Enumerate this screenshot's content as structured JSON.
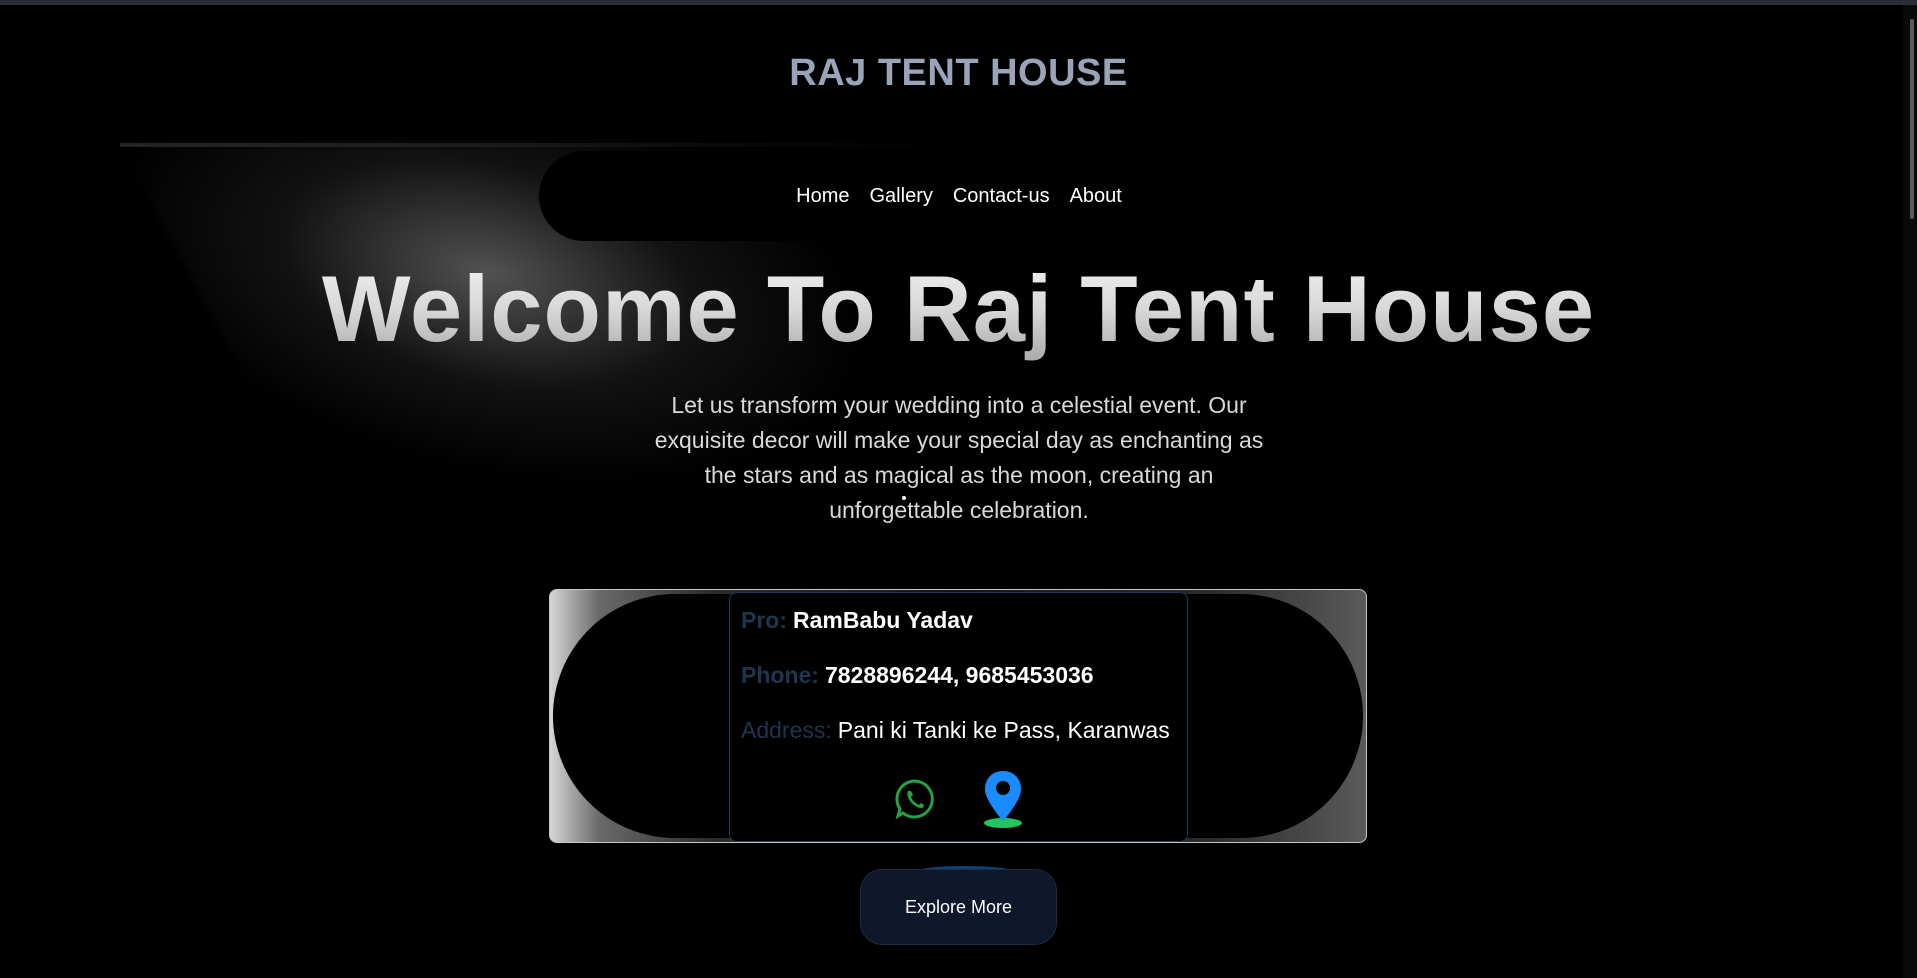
{
  "brand": {
    "title": "RAJ TENT HOUSE"
  },
  "nav": {
    "items": [
      {
        "label": "Home"
      },
      {
        "label": "Gallery"
      },
      {
        "label": "Contact-us"
      },
      {
        "label": "About"
      }
    ]
  },
  "hero": {
    "title": "Welcome To Raj Tent House",
    "description": "Let us transform your wedding into a celestial event. Our exquisite decor will make your special day as enchanting as the stars and as magical as the moon, creating an unforgettable celebration."
  },
  "contact": {
    "pro_label": "Pro:",
    "pro_value": "RamBabu Yadav",
    "phone_label": "Phone:",
    "phone_value": "7828896244, 9685453036",
    "address_label": "Address:",
    "address_value": "Pani ki Tanki ke Pass, Karanwas",
    "icons": [
      "whatsapp-icon",
      "location-pin-icon"
    ]
  },
  "cta": {
    "label": "Explore More"
  },
  "colors": {
    "background": "#000000",
    "brand": "#9aa4b8",
    "label_blue": "#1e3550",
    "whatsapp_green": "#25a244",
    "pin_blue": "#1a8cff",
    "button_bg": "#0f172a"
  }
}
